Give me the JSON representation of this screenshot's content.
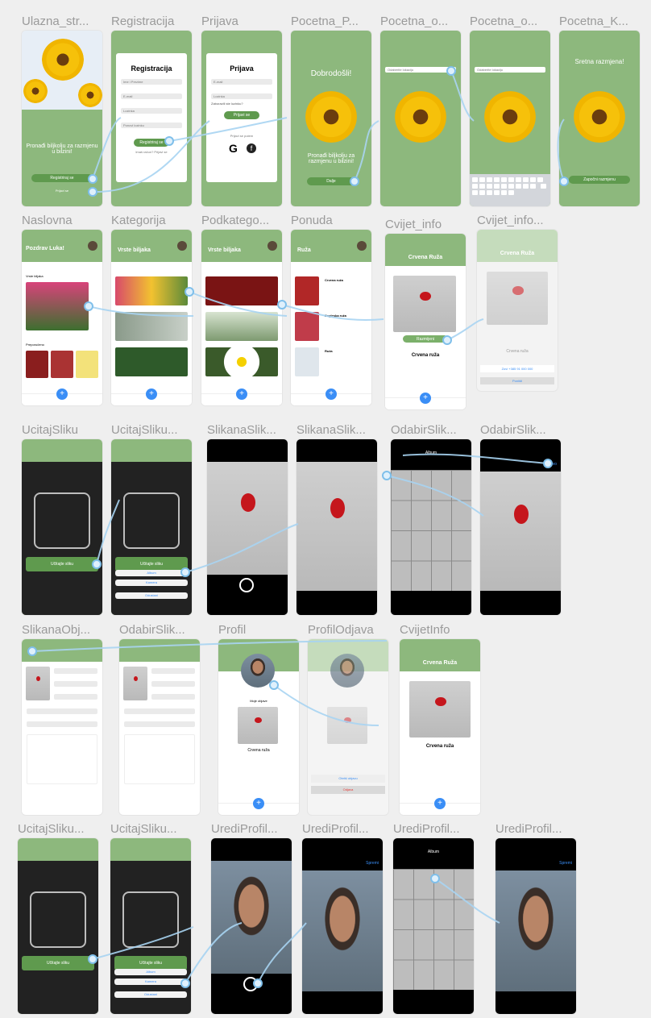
{
  "frames": {
    "ulazna": {
      "title": "Ulazna_str...",
      "tagline": "Pronađi biljkolju za razmjenu u bilzini!",
      "button": "Registriraj se",
      "link": "Prijavi se"
    },
    "registracija": {
      "title": "Registracija",
      "heading": "Registracija",
      "fields": [
        "Ime i Prezime",
        "E-mail",
        "Lozinka",
        "Ponovi lozinku"
      ],
      "button": "Registriraj se",
      "link": "Imaš račun? Prijavi se"
    },
    "prijava": {
      "title": "Prijava",
      "heading": "Prijava",
      "fields": [
        "E-mail",
        "Lozinka"
      ],
      "forgot": "Zaboravili ste lozinku?",
      "button": "Prijavi se",
      "alt": "Prijavi se putem"
    },
    "pocetna_p": {
      "title": "Pocetna_P...",
      "heading": "Dobrodošli!",
      "tagline": "Pronađi biljkolju za razmjenu u bilzini!",
      "button": "Dalje"
    },
    "pocetna_o1": {
      "title": "Pocetna_o...",
      "field": "Odaberite lokaciju"
    },
    "pocetna_o2": {
      "title": "Pocetna_o...",
      "field": "Odaberite lokaciju"
    },
    "pocetna_k": {
      "title": "Pocetna_K...",
      "heading": "Sretna razmjena!",
      "button": "Započni razmjenu"
    },
    "naslovna": {
      "title": "Naslovna",
      "greeting": "Pozdrav Luka!",
      "section1": "Vrste biljaka",
      "section2": "Preporučeno"
    },
    "kategorija": {
      "title": "Kategorija",
      "heading": "Vrste biljaka"
    },
    "podkategorija": {
      "title": "Podkatego...",
      "heading": "Vrste biljaka"
    },
    "ponuda": {
      "title": "Ponuda",
      "heading": "Ruža",
      "items": [
        "Crvena ruža",
        "Engleska ruža",
        "Ruža"
      ]
    },
    "cvijet_info": {
      "title": "Cvijet_info",
      "heading": "Crvena Ruža",
      "name": "Crvena ruža",
      "button": "Razmijeni"
    },
    "cvijet_info2": {
      "title": "Cvijet_info...",
      "heading": "Crvena Ruža",
      "name": "Crvena ruža",
      "phone": "Zovi +385 91 000 000",
      "cancel": "Poništi"
    },
    "ucitaj1": {
      "title": "UcitajSliku",
      "button": "Učitajte sliku"
    },
    "ucitaj2": {
      "title": "UcitajSliku...",
      "button": "Učitajte sliku",
      "options": [
        "Album",
        "Kamera",
        "Odustani"
      ]
    },
    "slikana1": {
      "title": "SlikanaSlik..."
    },
    "slikana2": {
      "title": "SlikanaSlik..."
    },
    "odabir1": {
      "title": "OdabirSlik...",
      "header": "Album"
    },
    "odabir2": {
      "title": "OdabirSlik...",
      "done": "Gotovo"
    },
    "slikana_obj": {
      "title": "SlikanaObj..."
    },
    "odabir3": {
      "title": "OdabirSlik..."
    },
    "profil": {
      "title": "Profil",
      "name": "Crvena ruža",
      "label": "Moje objave"
    },
    "profil_odjava": {
      "title": "ProfilOdjava",
      "options": [
        "Obriši objavu",
        "Odjava"
      ]
    },
    "cvijetinfo": {
      "title": "CvijetInfo",
      "heading": "Crvena Ruža",
      "name": "Crvena ruža"
    },
    "ucitaj3": {
      "title": "UcitajSliku...",
      "button": "Učitajte sliku"
    },
    "ucitaj4": {
      "title": "UcitajSliku...",
      "button": "Učitajte sliku",
      "options": [
        "Album",
        "Kamera",
        "Odustani"
      ]
    },
    "uredi1": {
      "title": "UrediProfil..."
    },
    "uredi2": {
      "title": "UrediProfil...",
      "done": "Spremi"
    },
    "uredi3": {
      "title": "UrediProfil...",
      "header": "Album"
    },
    "uredi4": {
      "title": "UrediProfil...",
      "done": "Spremi"
    }
  },
  "colors": {
    "brand_green": "#8db87d",
    "button_green": "#5f9a4e",
    "connector": "#a8d4f2",
    "accent_blue": "#3a8ef6"
  }
}
